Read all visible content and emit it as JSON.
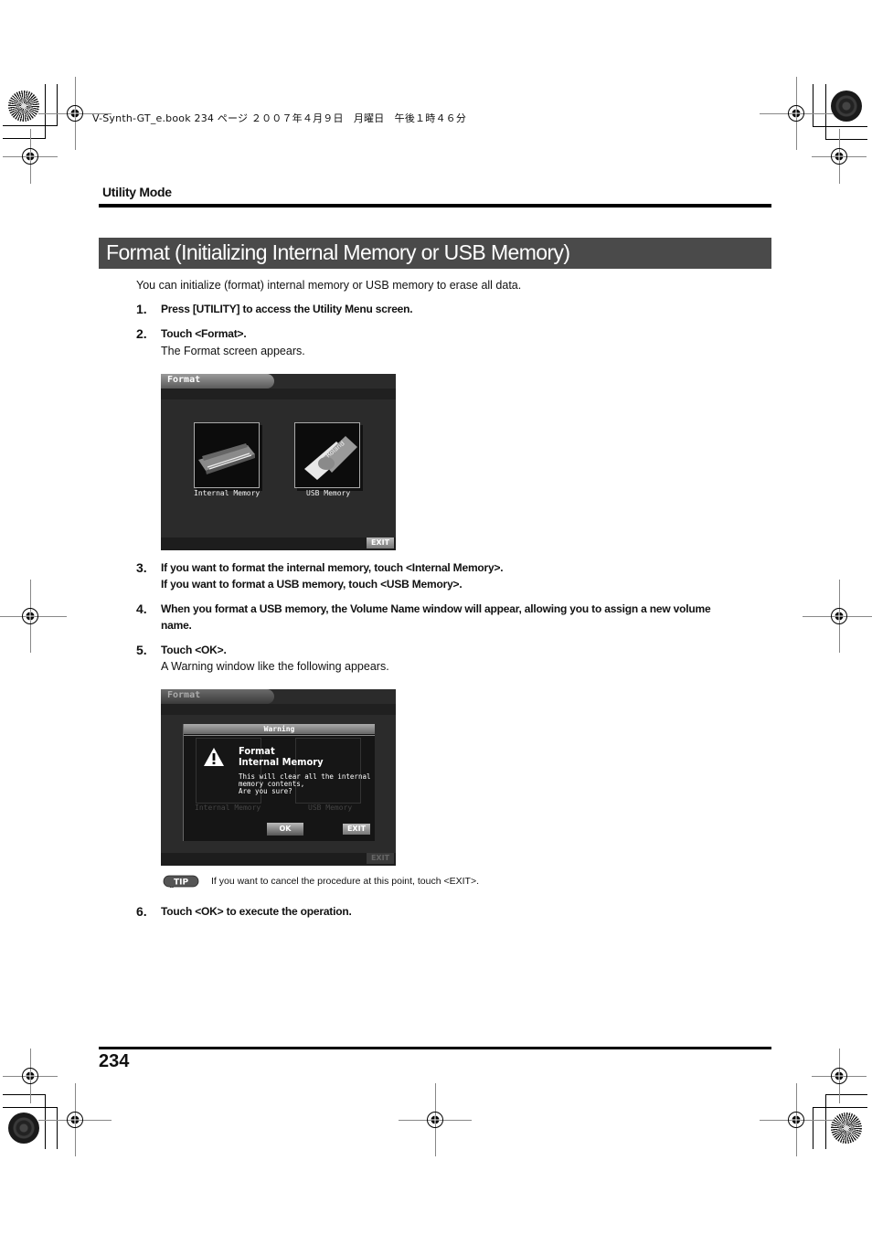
{
  "print_header": {
    "book_meta": "V-Synth-GT_e.book  234 ページ  ２００７年４月９日　月曜日　午後１時４６分"
  },
  "running_head": "Utility Mode",
  "title": "Format (Initializing Internal Memory or USB Memory)",
  "intro": "You can initialize (format) internal memory or USB memory to erase all data.",
  "steps": [
    {
      "number": "1.",
      "text": "Press [UTILITY] to access the Utility Menu screen."
    },
    {
      "number": "2.",
      "text": "Touch <Format>.",
      "sub": "The Format screen appears."
    },
    {
      "number": "3.",
      "text": "If you want to format the internal memory, touch <Internal Memory>.",
      "text2": "If you want to format a USB memory, touch <USB Memory>."
    },
    {
      "number": "4.",
      "text": "When you format a USB memory, the Volume Name window will appear, allowing you to assign a new volume",
      "text2": "name."
    },
    {
      "number": "5.",
      "text": "Touch <OK>.",
      "sub": "A Warning window like the following appears."
    },
    {
      "number": "6.",
      "text": "Touch <OK> to execute the operation."
    }
  ],
  "screen_format": {
    "tab_title": "Format",
    "items": [
      {
        "label": "Internal Memory",
        "icon": "keyboard-synth-image"
      },
      {
        "label": "USB Memory",
        "icon": "usb-stick-image"
      }
    ],
    "exit_label": "EXIT"
  },
  "screen_warning": {
    "tab_title": "Format",
    "dialog_title": "Warning",
    "heading_line1": "Format",
    "heading_line2": "Internal Memory",
    "message_line1": "This will clear all the internal",
    "message_line2": "memory contents,",
    "message_line3": "Are you sure?",
    "bg_items": [
      "Internal Memory",
      "USB Memory"
    ],
    "ok_label": "OK",
    "exit_label": "EXIT",
    "bg_exit_label": "EXIT"
  },
  "tip": {
    "badge": "TIP",
    "text": "If you want to cancel the procedure at this point, touch <EXIT>."
  },
  "page_number": "234"
}
